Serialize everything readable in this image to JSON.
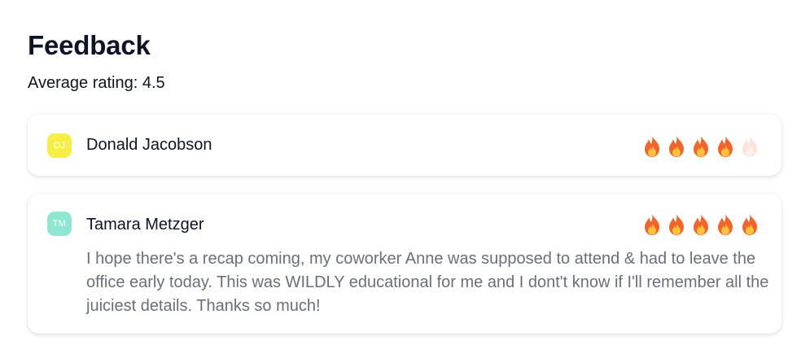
{
  "header": {
    "title": "Feedback",
    "average_rating_text": "Average rating: 4.5"
  },
  "colors": {
    "flame_active_outer": "#f2642a",
    "flame_active_inner": "#ffc23b",
    "flame_inactive": "#fbe3dc"
  },
  "feedback": [
    {
      "initials": "DJ",
      "avatar_color": "#f7ee45",
      "name": "Donald Jacobson",
      "rating": 4,
      "max_rating": 5,
      "rating_icon": "fire-icon",
      "comment": ""
    },
    {
      "initials": "TM",
      "avatar_color": "#8fe6d1",
      "name": "Tamara Metzger",
      "rating": 5,
      "max_rating": 5,
      "rating_icon": "fire-icon",
      "comment": "I hope there's a recap coming, my coworker Anne was supposed to attend & had to leave the office early today. This was WILDLY educational for me and I dont't know if I'll remember all the juiciest details. Thanks so much!"
    }
  ]
}
